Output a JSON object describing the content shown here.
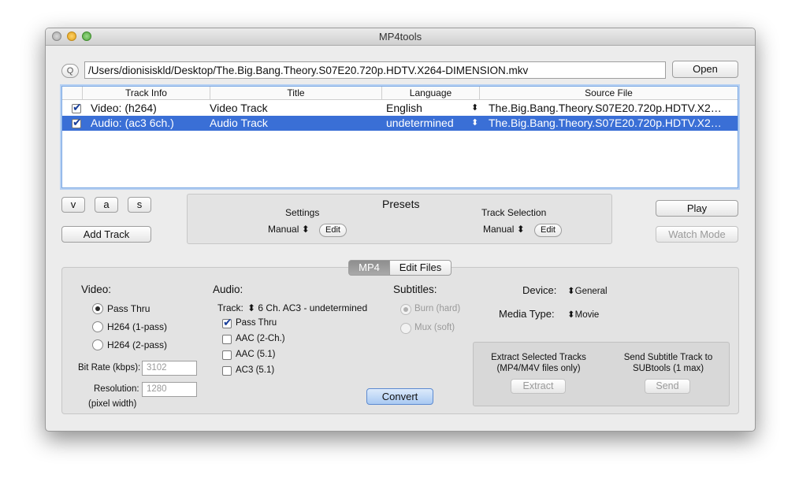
{
  "window": {
    "title": "MP4tools"
  },
  "toolbar": {
    "path_value": "/Users/dionisiskld/Desktop/The.Big.Bang.Theory.S07E20.720p.HDTV.X264-DIMENSION.mkv",
    "search_glyph": "Q",
    "open_label": "Open"
  },
  "table": {
    "headers": [
      "Track Info",
      "Title",
      "Language",
      "Source File"
    ],
    "rows": [
      {
        "checked": true,
        "info": "Video: (h264)",
        "title": "Video Track",
        "language": "English",
        "source": "The.Big.Bang.Theory.S07E20.720p.HDTV.X2…",
        "selected": false
      },
      {
        "checked": true,
        "info": "Audio: (ac3 6ch.)",
        "title": "Audio Track",
        "language": "undetermined",
        "source": "The.Big.Bang.Theory.S07E20.720p.HDTV.X2…",
        "selected": true
      }
    ]
  },
  "track_buttons": {
    "v": "v",
    "a": "a",
    "s": "s",
    "add": "Add Track"
  },
  "presets": {
    "title": "Presets",
    "settings_label": "Settings",
    "settings_value": "Manual",
    "track_selection_label": "Track Selection",
    "track_selection_value": "Manual",
    "edit_label": "Edit"
  },
  "right_buttons": {
    "play": "Play",
    "watch_mode": "Watch Mode"
  },
  "tabs": {
    "mp4": "MP4",
    "edit_files": "Edit Files"
  },
  "video": {
    "heading": "Video:",
    "options": [
      "Pass Thru",
      "H264 (1-pass)",
      "H264 (2-pass)"
    ],
    "selected": "Pass Thru",
    "bitrate_label": "Bit Rate (kbps):",
    "bitrate_value": "3102",
    "resolution_label": "Resolution:",
    "resolution_value": "1280",
    "resolution_note": "(pixel width)"
  },
  "audio": {
    "heading": "Audio:",
    "track_label": "Track:",
    "track_value": "6 Ch. AC3 - undetermined",
    "options": [
      {
        "label": "Pass Thru",
        "checked": true
      },
      {
        "label": "AAC (2-Ch.)",
        "checked": false
      },
      {
        "label": "AAC (5.1)",
        "checked": false
      },
      {
        "label": "AC3 (5.1)",
        "checked": false
      }
    ]
  },
  "subtitles": {
    "heading": "Subtitles:",
    "options": [
      "Burn (hard)",
      "Mux (soft)"
    ],
    "selected": "Burn (hard)"
  },
  "device": {
    "label": "Device:",
    "value": "General"
  },
  "media_type": {
    "label": "Media Type:",
    "value": "Movie"
  },
  "extract": {
    "text_line1": "Extract Selected Tracks",
    "text_line2": "(MP4/M4V files only)",
    "button": "Extract"
  },
  "send": {
    "text_line1": "Send Subtitle Track to",
    "text_line2": "SUBtools (1 max)",
    "button": "Send"
  },
  "convert": {
    "label": "Convert"
  },
  "colors": {
    "selection": "#3a6fd6",
    "convert_button": "#bcd6f6"
  }
}
